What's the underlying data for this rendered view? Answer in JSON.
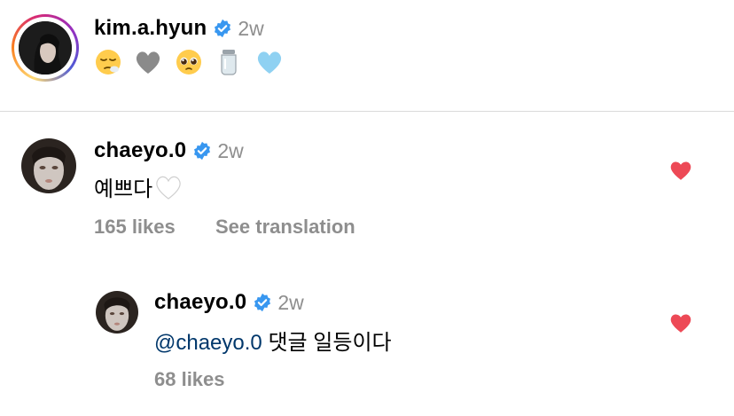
{
  "post": {
    "username": "kim.a.hyun",
    "time_ago": "2w",
    "emojis": [
      "sleepy-face-icon",
      "grey-heart-icon",
      "pleading-face-icon",
      "jar-icon",
      "light-blue-heart-icon"
    ]
  },
  "comments": [
    {
      "username": "chaeyo.0",
      "time_ago": "2w",
      "text": "예쁘다",
      "emoji": "white-heart-icon",
      "likes": "165 likes",
      "translate": "See translation",
      "liked": true
    },
    {
      "username": "chaeyo.0",
      "time_ago": "2w",
      "mention": "@chaeyo.0",
      "text": "댓글 일등이다",
      "likes": "68 likes",
      "liked": true
    }
  ],
  "colors": {
    "verified": "#3897f0",
    "heart": "#ed4956",
    "meta": "#8e8e8e",
    "mention": "#00376b"
  }
}
